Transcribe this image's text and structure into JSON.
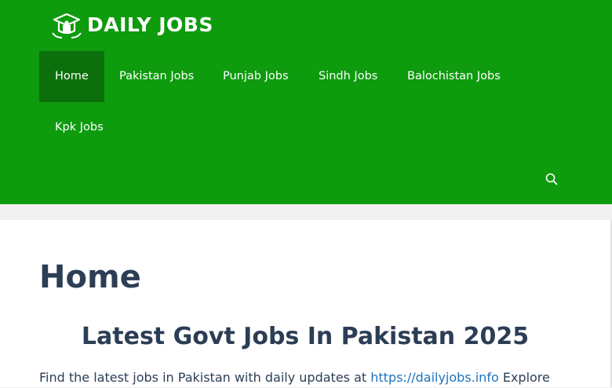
{
  "site": {
    "logo_text": "DAILY JOBS"
  },
  "nav": {
    "items": [
      {
        "label": "Home",
        "active": true
      },
      {
        "label": "Pakistan Jobs",
        "active": false
      },
      {
        "label": "Punjab Jobs",
        "active": false
      },
      {
        "label": "Sindh Jobs",
        "active": false
      },
      {
        "label": "Balochistan Jobs",
        "active": false
      },
      {
        "label": "Kpk Jobs",
        "active": false
      }
    ],
    "search_icon": "search-icon"
  },
  "page": {
    "title": "Home",
    "headline": "Latest Govt Jobs In Pakistan 2025",
    "intro_before": "Find the latest jobs in Pakistan with daily updates at ",
    "intro_link": "https://dailyjobs.info",
    "intro_after": " Explore"
  },
  "colors": {
    "header_bg": "#0e9b0e",
    "nav_active_bg": "#0b700b",
    "text": "#2c3e55",
    "link": "#1e73be"
  }
}
